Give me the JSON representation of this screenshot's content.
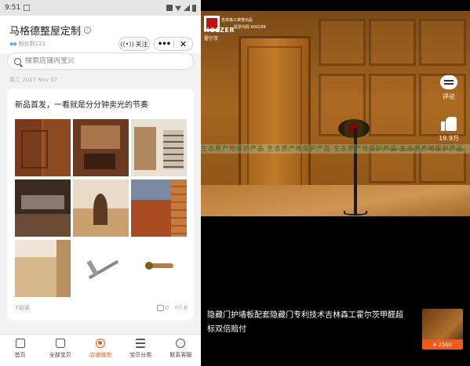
{
  "left": {
    "status_bar": {
      "time": "9:51"
    },
    "shop": {
      "name": "马格德整屋定制",
      "fans": "粉丝数121",
      "follow_label": "关注",
      "more_label": "•••",
      "close_label": "✕"
    },
    "search": {
      "placeholder": "搜索店铺内宝贝"
    },
    "post_date": "周二 2017 Nov 07",
    "post": {
      "title": "新品首发，一看就是分分钟卖光的节奏",
      "reads": "7阅读",
      "comment_count": "0",
      "like_count": "0"
    },
    "tabs": [
      {
        "label": "首页",
        "icon": "storefront-icon"
      },
      {
        "label": "全部宝贝",
        "icon": "shopping-bag-icon"
      },
      {
        "label": "店铺微淘",
        "icon": "broadcast-icon"
      },
      {
        "label": "宝贝分类",
        "icon": "list-icon"
      },
      {
        "label": "联系客服",
        "icon": "service-icon"
      }
    ],
    "active_color": "#f25a1b"
  },
  "right": {
    "logo": {
      "brand": "HOLZER",
      "brand_cn": "霍尔茨",
      "line1": "吉林森工荣誉出品",
      "line2": "股票代码 600189"
    },
    "watermark": "生态原产地保护产品  生态原产地保护产品  生态原产地保护产品  生态原产地保护产品",
    "comment_label": "评论",
    "like_count": "19.9万",
    "caption": "隐藏门护墙板配套隐藏门专利技术吉林森工霍尔茨甲醛超标双倍赔付",
    "product_price": "¥ 2500"
  }
}
